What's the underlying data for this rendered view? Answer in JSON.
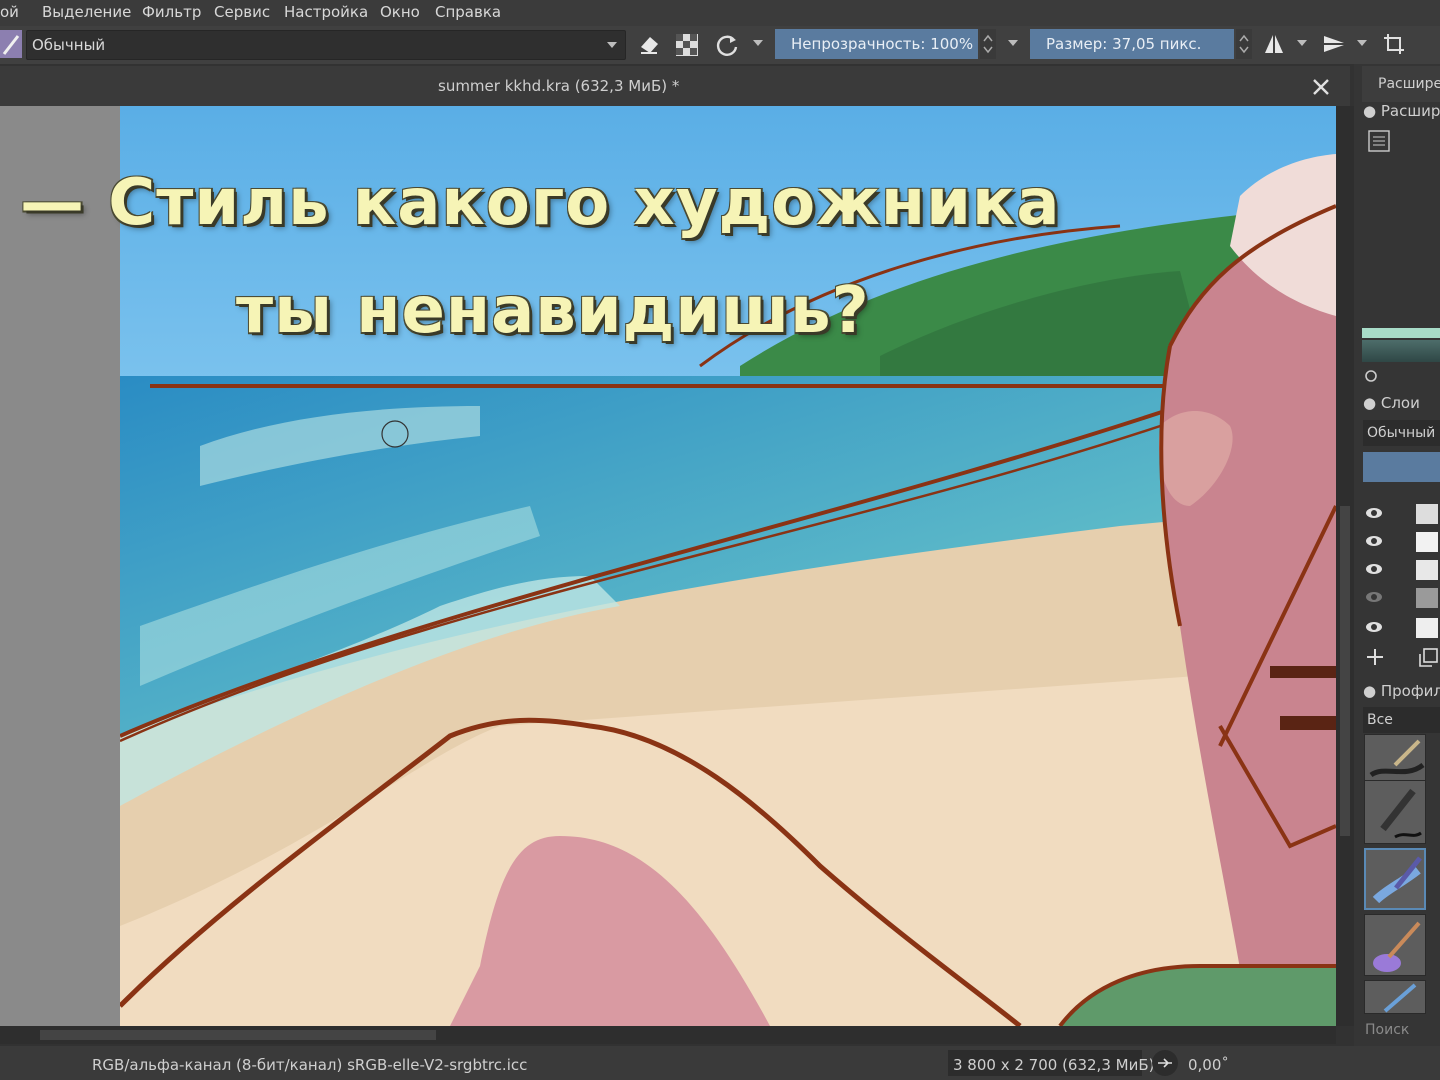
{
  "menu": {
    "items": [
      "ой",
      "Выделение",
      "Фильтр",
      "Сервис",
      "Настройка",
      "Окно",
      "Справка"
    ]
  },
  "toolbar": {
    "blend_mode": "Обычный",
    "opacity_label": "Непрозрачность: 100%",
    "size_label": "Размер: 37,05 пикс.",
    "icons": [
      "brush-preset-icon",
      "eraser-icon",
      "alpha-lock-icon",
      "reload-icon",
      "mirror-horizontal-icon",
      "mirror-vertical-icon",
      "crop-icon"
    ]
  },
  "document": {
    "title": "summer kkhd.kra (632,3 МиБ) *"
  },
  "canvas": {
    "caption_line1": "— Стиль какого художника",
    "caption_line2": "ты ненавидишь?"
  },
  "status": {
    "color_profile": "RGB/альфа-канал (8-бит/канал)  sRGB-elle-V2-srgbtrc.icc",
    "dimensions": "3 800 x 2 700 (632,3 МиБ)",
    "rotation": "0,00˚"
  },
  "docker": {
    "tab_top": "Расшире",
    "advanced_color": "Расшир",
    "layers_title": "Слои",
    "layers_blend": "Обычный",
    "brush_presets_title": "Профил",
    "brush_filter": "Все",
    "search_placeholder": "Поиск"
  }
}
